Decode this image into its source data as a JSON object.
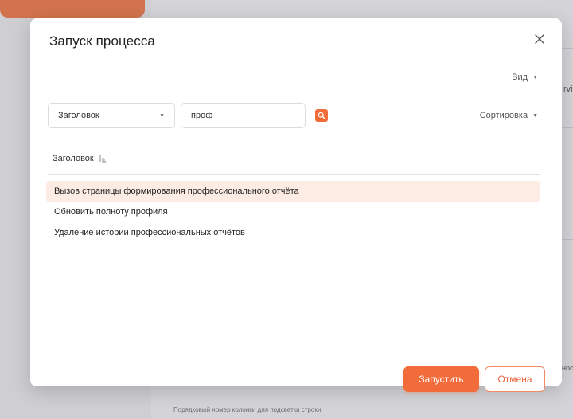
{
  "modal": {
    "title": "Запуск процесса",
    "view_label": "Вид",
    "field_select_value": "Заголовок",
    "search_value": "проф",
    "sort_label": "Сортировка",
    "column_header": "Заголовок",
    "rows": [
      {
        "title": "Вызов страницы формирования профессионального отчёта",
        "selected": true
      },
      {
        "title": "Обновить полноту профиля",
        "selected": false
      },
      {
        "title": "Удаление истории профессиональных отчётов",
        "selected": false
      }
    ],
    "run_button": "Запустить",
    "cancel_button": "Отмена"
  },
  "background": {
    "edge_text_top": "rvi",
    "edge_text_bottom": "нос",
    "hint_text": "Порядковый номер колонки для подсветки строки"
  },
  "colors": {
    "accent": "#f26b3a",
    "selected_row": "#fdece4"
  },
  "icons": {
    "close": "close-icon",
    "search": "search-icon",
    "sort": "sort-icon",
    "caret": "chevron-down-icon"
  }
}
